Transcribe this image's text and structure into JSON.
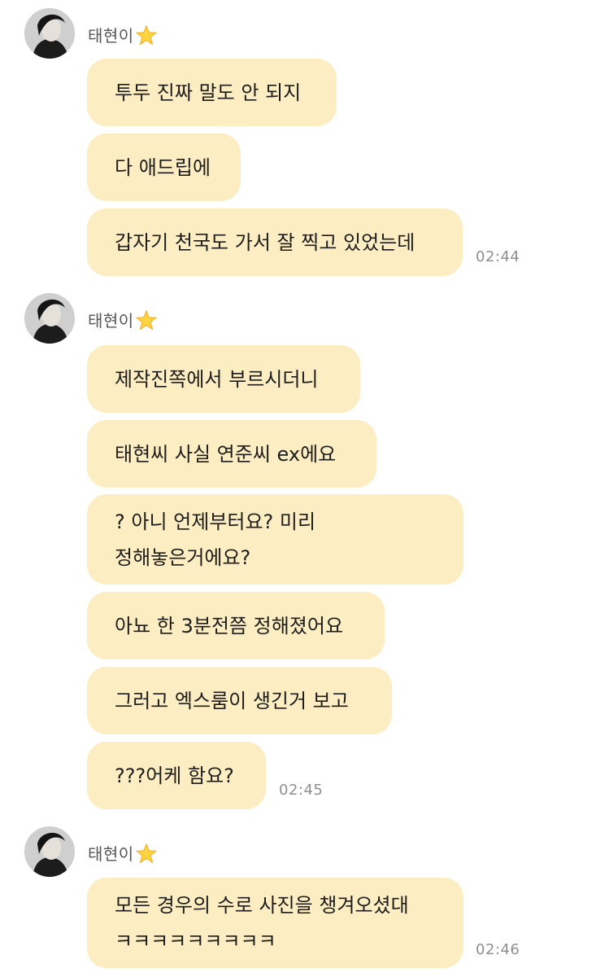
{
  "groups": [
    {
      "sender": "태현이",
      "messages": [
        "투두 진짜 말도 안 되지",
        "다 애드립에",
        "갑자기 천국도 가서 잘 찍고 있었는데"
      ],
      "time": "02:44"
    },
    {
      "sender": "태현이",
      "messages": [
        "제작진쪽에서 부르시더니",
        "태현씨 사실 연준씨 ex에요",
        [
          "? 아니 언제부터요? 미리",
          "정해놓은거에요?"
        ],
        "아뇨 한 3분전쯤 정해졌어요",
        "그러고 엑스룸이 생긴거 보고",
        "???어케 함요?"
      ],
      "time": "02:45"
    },
    {
      "sender": "태현이",
      "messages": [
        [
          "모든 경우의 수로 사진을 챙겨오셨대",
          "ㅋㅋㅋㅋㅋㅋㅋㅋㅋ"
        ]
      ],
      "time": "02:46"
    }
  ],
  "icons": {
    "sender_badge": "star-icon",
    "avatar": "profile-photo"
  },
  "colors": {
    "bubble": "#fdedc2",
    "timestamp": "#8f8f8f",
    "sender_name": "#555555"
  }
}
